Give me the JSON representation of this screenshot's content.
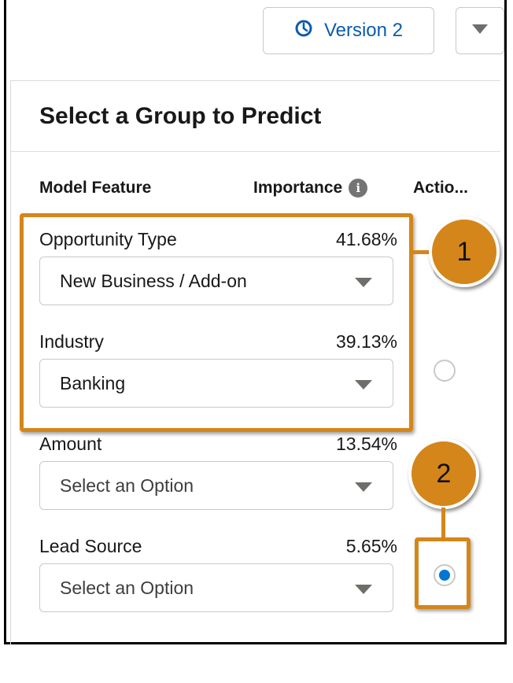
{
  "toolbar": {
    "version_label": "Version 2"
  },
  "panel": {
    "title": "Select a Group to Predict",
    "columns": {
      "feature": "Model Feature",
      "importance": "Importance",
      "action": "Actio..."
    }
  },
  "features": [
    {
      "name": "Opportunity Type",
      "importance": "41.68%",
      "value": "New Business / Add-on"
    },
    {
      "name": "Industry",
      "importance": "39.13%",
      "value": "Banking"
    },
    {
      "name": "Amount",
      "importance": "13.54%",
      "placeholder": "Select an Option"
    },
    {
      "name": "Lead Source",
      "importance": "5.65%",
      "placeholder": "Select an Option"
    }
  ],
  "callouts": {
    "one": "1",
    "two": "2"
  },
  "colors": {
    "accent_link": "#0b5cab",
    "callout": "#d4861a",
    "radio_selected": "#0176d3"
  }
}
